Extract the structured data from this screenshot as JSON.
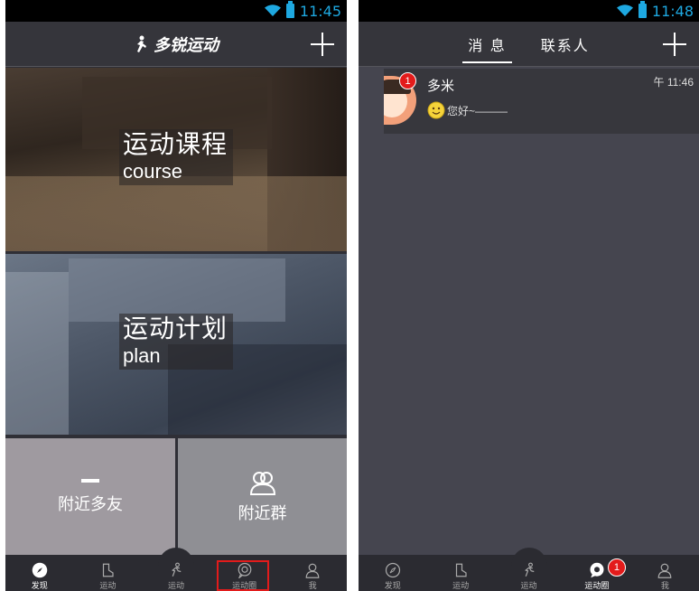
{
  "left_screen": {
    "status_time": "11:45",
    "app_title": "多锐运动",
    "tiles": [
      {
        "zh": "运动课程",
        "en": "course"
      },
      {
        "zh": "运动计划",
        "en": "plan"
      },
      {
        "label": "附近多友"
      },
      {
        "label": "附近群"
      }
    ],
    "tabs": [
      {
        "label": "发现",
        "icon": "compass-icon"
      },
      {
        "label": "运动",
        "icon": "shoe-icon"
      },
      {
        "label": "运动",
        "icon": "runner-icon"
      },
      {
        "label": "运动圈",
        "icon": "chat-bubble-icon"
      },
      {
        "label": "我",
        "icon": "person-icon"
      }
    ],
    "highlight_color": "#e21b1b"
  },
  "right_screen": {
    "status_time": "11:48",
    "tabs": [
      "消 息",
      "联系人"
    ],
    "conversation": {
      "name": "多米",
      "time": "午 11:46",
      "preview": "您好~———",
      "unread": "1"
    },
    "tabs_bottom": [
      {
        "label": "发现",
        "icon": "compass-icon"
      },
      {
        "label": "运动",
        "icon": "shoe-icon"
      },
      {
        "label": "运动",
        "icon": "runner-icon"
      },
      {
        "label": "运动圈",
        "icon": "chat-bubble-icon",
        "badge": "1"
      },
      {
        "label": "我",
        "icon": "person-icon"
      }
    ]
  },
  "colors": {
    "status_accent": "#1ea8e0",
    "badge": "#e31b1b"
  }
}
